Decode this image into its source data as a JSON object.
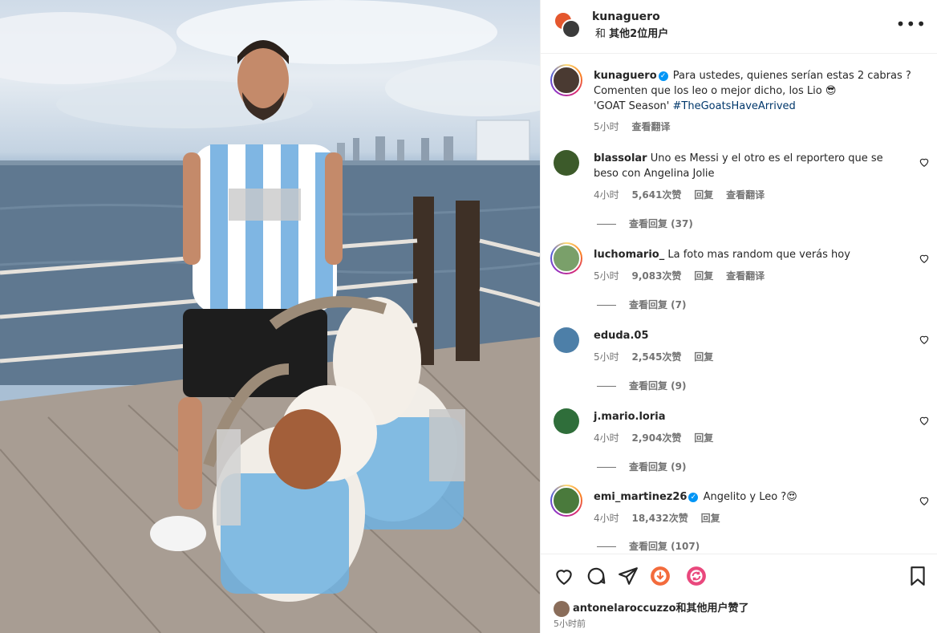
{
  "header": {
    "username": "kunaguero",
    "coauthor_prefix": "和",
    "coauthor_link": "其他2位用户",
    "more_label": "•••"
  },
  "caption": {
    "username": "kunaguero",
    "text_line1": "Para ustedes, quienes serían estas 2 cabras ?",
    "text_line2": "Comenten que los leo o mejor dicho, los Lio 😎",
    "text_line3": "'GOAT Season'",
    "hashtag": "#TheGoatsHaveArrived",
    "time": "5小时",
    "translate": "查看翻译"
  },
  "comments": [
    {
      "username": "blassolar",
      "text": "Uno es Messi y el otro es el reportero que se beso con Angelina Jolie",
      "time": "4小时",
      "likes": "5,641次赞",
      "reply": "回复",
      "translate": "查看翻译",
      "view_replies": "查看回复 (37)",
      "avatar_color": "#3c5a2a"
    },
    {
      "username": "luchomario_",
      "text": "La foto mas random que verás hoy",
      "time": "5小时",
      "likes": "9,083次赞",
      "reply": "回复",
      "translate": "查看翻译",
      "view_replies": "查看回复 (7)",
      "avatar_color": "#7aa06a"
    },
    {
      "username": "eduda.05",
      "text": "",
      "time": "5小时",
      "likes": "2,545次赞",
      "reply": "回复",
      "translate": "",
      "view_replies": "查看回复 (9)",
      "avatar_color": "#4d7fa8"
    },
    {
      "username": "j.mario.loria",
      "text": "",
      "time": "4小时",
      "likes": "2,904次赞",
      "reply": "回复",
      "translate": "",
      "view_replies": "查看回复 (9)",
      "avatar_color": "#2f6e3a"
    },
    {
      "username": "emi_martinez26",
      "text": "Angelito y Leo ?😍",
      "time": "4小时",
      "likes": "18,432次赞",
      "reply": "回复",
      "translate": "",
      "view_replies": "查看回复 (107)",
      "avatar_color": "#4a7a3c"
    }
  ],
  "footer": {
    "liked_by_user": "antonelaroccuzzo",
    "liked_by_suffix": "和其他用户赞了",
    "time": "5小时前"
  },
  "colors": {
    "link": "#00376b",
    "verified": "#0095f6",
    "secondary_text": "#737373"
  }
}
